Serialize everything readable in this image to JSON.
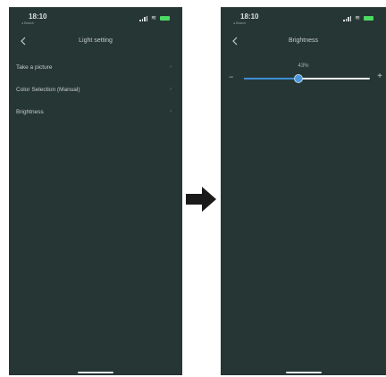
{
  "left_screen": {
    "status_bar": {
      "time": "18:10",
      "back_app": "Search"
    },
    "nav": {
      "title": "Light setting"
    },
    "menu_items": [
      {
        "label": "Take a picture"
      },
      {
        "label": "Color Selection (Manual)"
      },
      {
        "label": "Brightness"
      }
    ]
  },
  "right_screen": {
    "status_bar": {
      "time": "18:10",
      "back_app": "Search"
    },
    "nav": {
      "title": "Brightness"
    },
    "slider": {
      "value_label": "43%",
      "value": 0.43,
      "min_symbol": "−",
      "max_symbol": "+"
    }
  },
  "colors": {
    "screen_background": "#263634",
    "slider_fill": "#3d8ed3",
    "slider_track": "#e8eeed",
    "battery": "#4cd964",
    "arrow": "#1a1a1a"
  },
  "icons": [
    "back-chevron-icon",
    "chevron-right-icon",
    "signal-icon",
    "wifi-icon",
    "battery-icon",
    "arrow-right-icon"
  ]
}
